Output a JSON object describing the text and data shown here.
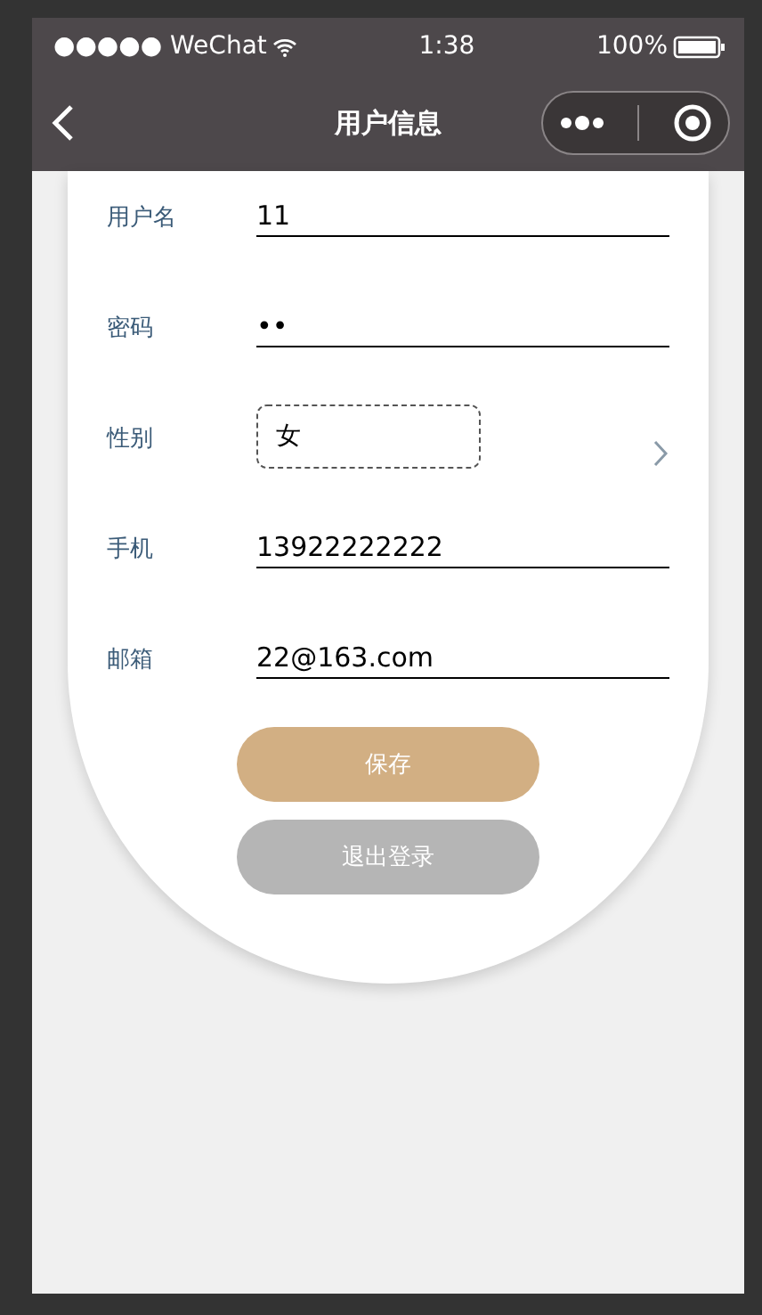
{
  "status_bar": {
    "carrier": "●●●●● WeChat",
    "time": "1:38",
    "battery": "100%"
  },
  "nav": {
    "title": "用户信息"
  },
  "fields": [
    {
      "kind": "input",
      "label": "用户名",
      "value": "11"
    },
    {
      "kind": "input",
      "label": "密码",
      "value": "••"
    },
    {
      "kind": "select",
      "label": "性别",
      "value": "女"
    },
    {
      "kind": "input",
      "label": "手机",
      "value": "13922222222"
    },
    {
      "kind": "input",
      "label": "邮箱",
      "value": "22@163.com"
    }
  ],
  "buttons": [
    {
      "label": "保存",
      "kind": "primary"
    },
    {
      "label": "退出登录",
      "kind": "secondary"
    }
  ]
}
